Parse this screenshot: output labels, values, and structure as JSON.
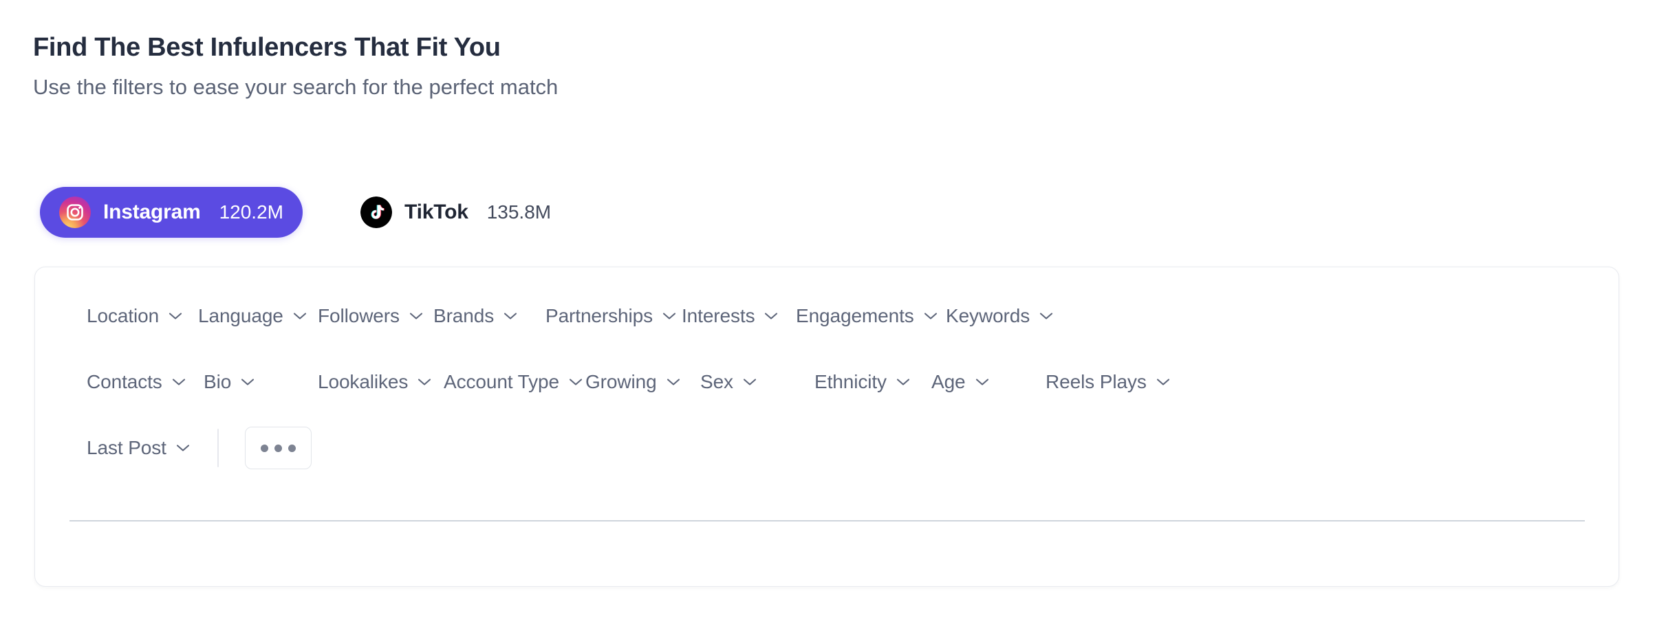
{
  "header": {
    "title": "Find The Best Infulencers That Fit You",
    "subtitle": "Use the filters to ease your search for the perfect match"
  },
  "platform_tabs": {
    "active_index": 0,
    "items": [
      {
        "id": "instagram",
        "label": "Instagram",
        "count": "120.2M",
        "icon": "instagram-icon",
        "active": true
      },
      {
        "id": "tiktok",
        "label": "TikTok",
        "count": "135.8M",
        "icon": "tiktok-icon",
        "active": false
      }
    ]
  },
  "filters": {
    "rows": [
      [
        {
          "label": "Location",
          "icon": "chevron-down-icon"
        },
        {
          "label": "Language",
          "icon": "chevron-down-icon"
        },
        {
          "label": "Followers",
          "icon": "chevron-down-icon"
        },
        {
          "label": "Brands",
          "icon": "chevron-down-icon"
        },
        {
          "label": "Partnerships",
          "icon": "chevron-down-icon"
        },
        {
          "label": "Interests",
          "icon": "chevron-down-icon"
        },
        {
          "label": "Engagements",
          "icon": "chevron-down-icon"
        },
        {
          "label": "Keywords",
          "icon": "chevron-down-icon"
        }
      ],
      [
        {
          "label": "Contacts",
          "icon": "chevron-down-icon"
        },
        {
          "label": "Bio",
          "icon": "chevron-down-icon"
        },
        {
          "label": "Lookalikes",
          "icon": "chevron-down-icon"
        },
        {
          "label": "Account Type",
          "icon": "chevron-down-icon"
        },
        {
          "label": "Growing",
          "icon": "chevron-down-icon"
        },
        {
          "label": "Sex",
          "icon": "chevron-down-icon"
        },
        {
          "label": "Ethnicity",
          "icon": "chevron-down-icon"
        },
        {
          "label": "Age",
          "icon": "chevron-down-icon"
        },
        {
          "label": "Reels Plays",
          "icon": "chevron-down-icon"
        }
      ],
      [
        {
          "label": "Last Post",
          "icon": "chevron-down-icon"
        }
      ]
    ],
    "more_button": {
      "icon": "more-horizontal-icon",
      "label": ""
    }
  },
  "colors": {
    "accent": "#5B4BE2",
    "title": "#252D3F",
    "subtitle": "#5A6275",
    "filter_label": "#5D6579",
    "card_border": "#E8EAEF",
    "divider": "#CFD4DC",
    "background": "#FFFFFF"
  }
}
